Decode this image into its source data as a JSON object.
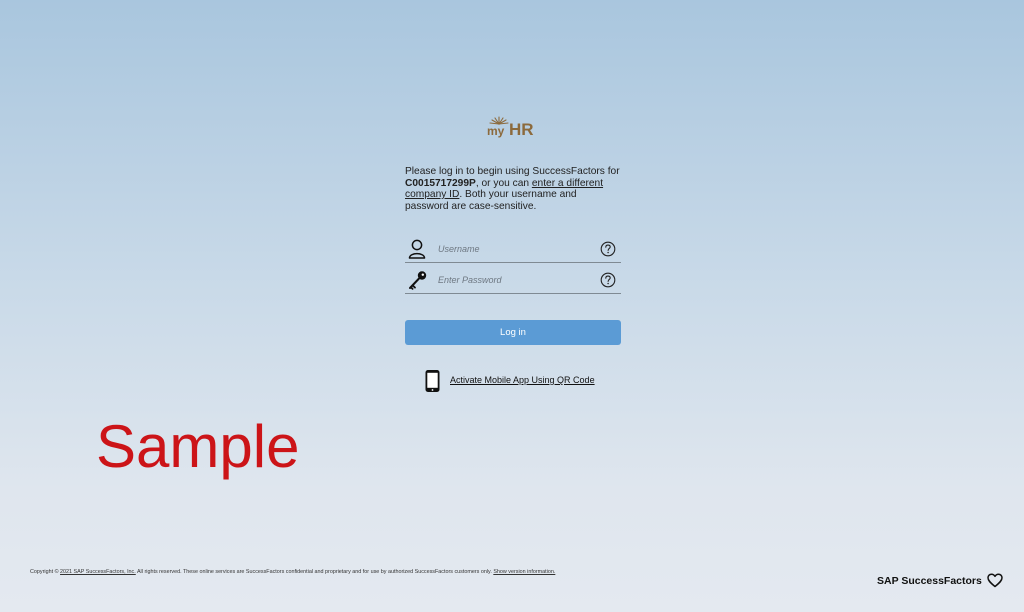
{
  "logo": {
    "my": "my",
    "hr": "HR"
  },
  "intro": {
    "line1": "Please log in to begin using SuccessFactors for ",
    "company_id": "C0015717299P",
    "line2": ", or you can ",
    "change_link": "enter a different company ID",
    "line3": ". Both your username and password are case-sensitive."
  },
  "form": {
    "username_placeholder": "Username",
    "password_placeholder": "Enter Password",
    "username_value": "",
    "password_value": "",
    "login_label": "Log in"
  },
  "mobile": {
    "link_label": "Activate Mobile App Using QR Code"
  },
  "watermark": "Sample",
  "footer": {
    "prefix": "Copyright © ",
    "company_link": "2021 SAP SuccessFactors, Inc.",
    "text": " All rights reserved. These online services are SuccessFactors confidential and proprietary and for use by authorized SuccessFactors customers only. ",
    "version_link": "Show version information."
  },
  "brand": "SAP SuccessFactors",
  "colors": {
    "accent": "#5b9bd5",
    "logo_brown": "#8c6a3c",
    "watermark_red": "#cc1418"
  },
  "icons": {
    "user": "user-icon",
    "key": "key-icon",
    "help": "help-circle-icon",
    "phone": "mobile-phone-icon",
    "heart": "heart-icon"
  }
}
